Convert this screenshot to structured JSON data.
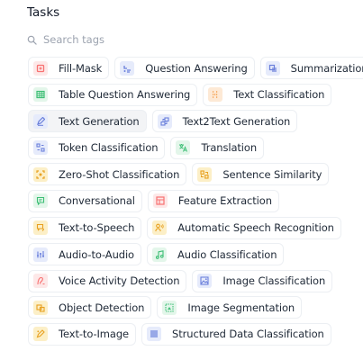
{
  "heading": "Tasks",
  "search": {
    "placeholder": "Search tags",
    "value": ""
  },
  "rows": [
    [
      {
        "label": "Fill-Mask",
        "icon": "fill-mask-icon",
        "color": "red"
      },
      {
        "label": "Question Answering",
        "icon": "question-answering-icon",
        "color": "indigo"
      },
      {
        "label": "Summarization",
        "icon": "summarization-icon",
        "color": "indigo"
      }
    ],
    [
      {
        "label": "Table Question Answering",
        "icon": "table-icon",
        "color": "green"
      },
      {
        "label": "Text Classification",
        "icon": "text-classification-icon",
        "color": "orange"
      }
    ],
    [
      {
        "label": "Text Generation",
        "icon": "text-generation-icon",
        "color": "indigo",
        "selected": true
      },
      {
        "label": "Text2Text Generation",
        "icon": "text2text-icon",
        "color": "indigo"
      }
    ],
    [
      {
        "label": "Token Classification",
        "icon": "token-classification-icon",
        "color": "indigo"
      },
      {
        "label": "Translation",
        "icon": "translation-icon",
        "color": "green"
      }
    ],
    [
      {
        "label": "Zero-Shot Classification",
        "icon": "zero-shot-icon",
        "color": "yellow"
      },
      {
        "label": "Sentence Similarity",
        "icon": "sentence-similarity-icon",
        "color": "yellow"
      }
    ],
    [
      {
        "label": "Conversational",
        "icon": "conversational-icon",
        "color": "green"
      },
      {
        "label": "Feature Extraction",
        "icon": "feature-extraction-icon",
        "color": "red"
      }
    ],
    [
      {
        "label": "Text-to-Speech",
        "icon": "text-to-speech-icon",
        "color": "yellow"
      },
      {
        "label": "Automatic Speech Recognition",
        "icon": "speech-recognition-icon",
        "color": "yellow"
      }
    ],
    [
      {
        "label": "Audio-to-Audio",
        "icon": "audio-to-audio-icon",
        "color": "indigo"
      },
      {
        "label": "Audio Classification",
        "icon": "audio-classification-icon",
        "color": "green"
      }
    ],
    [
      {
        "label": "Voice Activity Detection",
        "icon": "voice-activity-icon",
        "color": "red"
      },
      {
        "label": "Image Classification",
        "icon": "image-classification-icon",
        "color": "indigo"
      }
    ],
    [
      {
        "label": "Object Detection",
        "icon": "object-detection-icon",
        "color": "yellow"
      },
      {
        "label": "Image Segmentation",
        "icon": "image-segmentation-icon",
        "color": "green"
      }
    ],
    [
      {
        "label": "Text-to-Image",
        "icon": "text-to-image-icon",
        "color": "yellow"
      },
      {
        "label": "Structured Data Classification",
        "icon": "structured-data-icon",
        "color": "indigo"
      }
    ]
  ]
}
